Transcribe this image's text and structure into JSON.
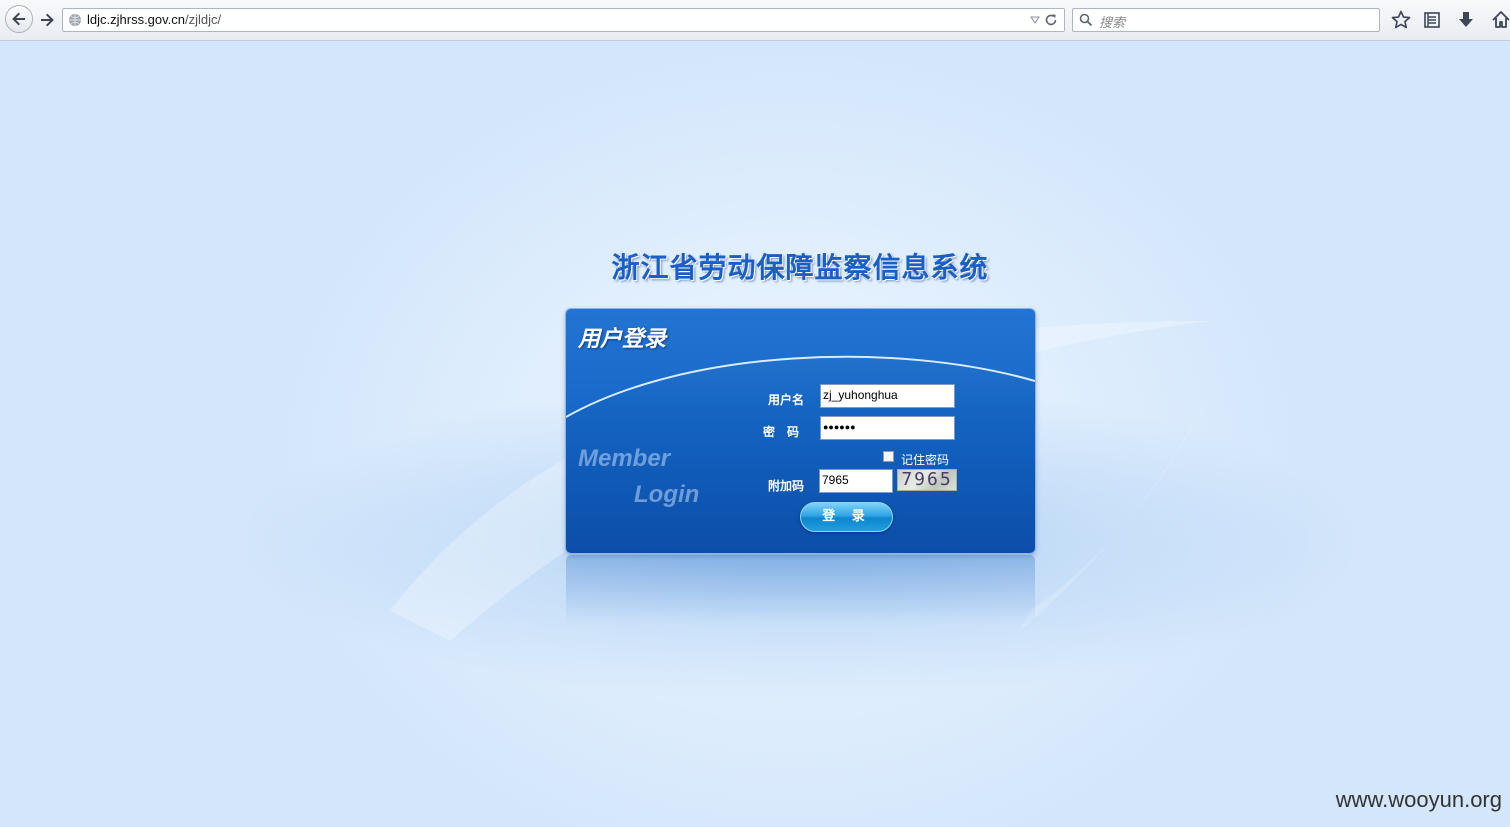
{
  "browser": {
    "url_host": "ldjc.zjhrss.gov.cn",
    "url_path": "/zjldjc/",
    "search_placeholder": "搜索"
  },
  "page": {
    "system_title": "浙江省劳动保障监察信息系统",
    "panel_title": "用户登录",
    "decor_member": "Member",
    "decor_login": "Login",
    "username_label": "用户名",
    "username_value": "zj_yuhonghua",
    "password_label": "密　码",
    "password_value": "●●●●●●",
    "remember_label": "记住密码",
    "remember_checked": false,
    "captcha_label": "附加码",
    "captcha_value": "7965",
    "captcha_image_text": "7965",
    "login_button": "登 录"
  },
  "watermark": "www.wooyun.org",
  "colors": {
    "panel": "#1565c3",
    "title": "#1a5fc6",
    "button": "#2fa5e3"
  }
}
